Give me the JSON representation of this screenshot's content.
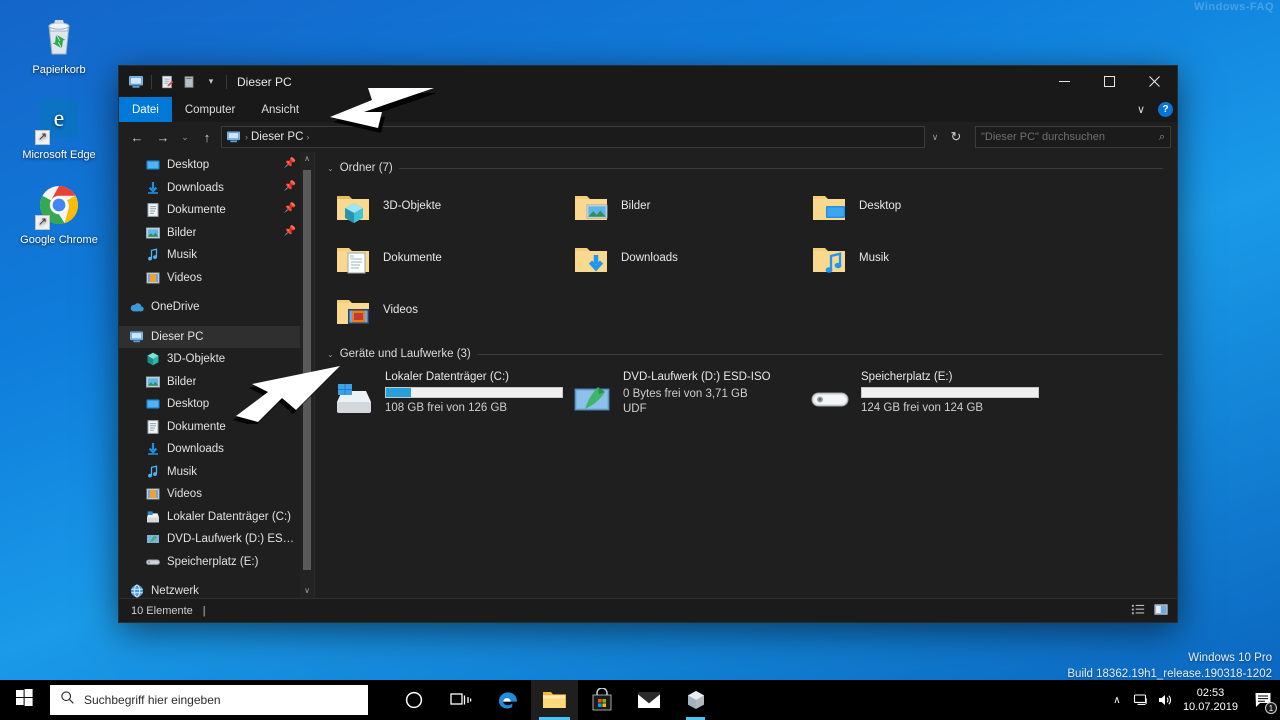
{
  "desktop": {
    "watermark_topright": "Windows-FAQ",
    "build_line1": "Windows 10 Pro",
    "build_line2": "Build 18362.19h1_release.190318-1202",
    "icons": [
      {
        "label": "Papierkorb",
        "icon": "recycle-bin-icon"
      },
      {
        "label": "Microsoft Edge",
        "icon": "edge-icon"
      },
      {
        "label": "Google Chrome",
        "icon": "chrome-icon"
      }
    ]
  },
  "window": {
    "title": "Dieser PC",
    "quick_access": [
      {
        "name": "properties-icon",
        "glyph": "✎"
      },
      {
        "name": "new-folder-icon",
        "glyph": "▤"
      },
      {
        "name": "qat-dropdown-icon",
        "glyph": "▾"
      }
    ],
    "controls": {
      "minimize": "─",
      "maximize": "☐",
      "close": "✕"
    },
    "ribbon": {
      "tabs": [
        {
          "label": "Datei",
          "active": true
        },
        {
          "label": "Computer",
          "active": false
        },
        {
          "label": "Ansicht",
          "active": false
        }
      ],
      "expand_label": "∨",
      "help_label": "?"
    },
    "address": {
      "back": "←",
      "forward": "→",
      "recent": "⌄",
      "up": "↑",
      "crumb_icon": "this-pc-icon",
      "crumb_text": "Dieser PC",
      "crumb_sep": "›",
      "history_caret": "∨",
      "refresh": "↻",
      "search_placeholder": "\"Dieser PC\" durchsuchen",
      "search_value": "",
      "search_icon": "⌕"
    },
    "status": {
      "item_count": "10 Elemente",
      "separator": "|",
      "view_details": "details-view-icon",
      "view_tiles": "tiles-view-icon"
    }
  },
  "nav_pane": {
    "scroll_up": "∧",
    "scroll_down": "∨",
    "items": [
      {
        "label": "Desktop",
        "icon": "desktop-folder-icon",
        "indent": 1,
        "pinned": true,
        "selected": false
      },
      {
        "label": "Downloads",
        "icon": "downloads-icon",
        "indent": 1,
        "pinned": true,
        "selected": false
      },
      {
        "label": "Dokumente",
        "icon": "documents-icon",
        "indent": 1,
        "pinned": true,
        "selected": false
      },
      {
        "label": "Bilder",
        "icon": "pictures-icon",
        "indent": 1,
        "pinned": true,
        "selected": false
      },
      {
        "label": "Musik",
        "icon": "music-icon",
        "indent": 1,
        "pinned": false,
        "selected": false
      },
      {
        "label": "Videos",
        "icon": "videos-icon",
        "indent": 1,
        "pinned": false,
        "selected": false
      },
      {
        "label": "OneDrive",
        "icon": "onedrive-icon",
        "indent": 0,
        "pinned": false,
        "selected": false
      },
      {
        "label": "Dieser PC",
        "icon": "this-pc-icon",
        "indent": 0,
        "pinned": false,
        "selected": true
      },
      {
        "label": "3D-Objekte",
        "icon": "3d-objects-icon",
        "indent": 1,
        "pinned": false,
        "selected": false
      },
      {
        "label": "Bilder",
        "icon": "pictures-icon",
        "indent": 1,
        "pinned": false,
        "selected": false
      },
      {
        "label": "Desktop",
        "icon": "desktop-folder-icon",
        "indent": 1,
        "pinned": false,
        "selected": false
      },
      {
        "label": "Dokumente",
        "icon": "documents-icon",
        "indent": 1,
        "pinned": false,
        "selected": false
      },
      {
        "label": "Downloads",
        "icon": "downloads-icon",
        "indent": 1,
        "pinned": false,
        "selected": false
      },
      {
        "label": "Musik",
        "icon": "music-icon",
        "indent": 1,
        "pinned": false,
        "selected": false
      },
      {
        "label": "Videos",
        "icon": "videos-icon",
        "indent": 1,
        "pinned": false,
        "selected": false
      },
      {
        "label": "Lokaler Datenträger (C:)",
        "icon": "hard-drive-icon",
        "indent": 1,
        "pinned": false,
        "selected": false
      },
      {
        "label": "DVD-Laufwerk (D:) ESD-ISO",
        "icon": "dvd-drive-icon",
        "indent": 1,
        "pinned": false,
        "selected": false
      },
      {
        "label": "Speicherplatz (E:)",
        "icon": "storage-drive-icon",
        "indent": 1,
        "pinned": false,
        "selected": false
      },
      {
        "label": "Netzwerk",
        "icon": "network-icon",
        "indent": 0,
        "pinned": false,
        "selected": false
      }
    ]
  },
  "content": {
    "group_folders": {
      "caret": "⌄",
      "title": "Ordner (7)",
      "items": [
        {
          "label": "3D-Objekte",
          "icon": "folder-3d-objects-icon"
        },
        {
          "label": "Bilder",
          "icon": "folder-pictures-icon"
        },
        {
          "label": "Desktop",
          "icon": "folder-desktop-icon"
        },
        {
          "label": "Dokumente",
          "icon": "folder-documents-icon"
        },
        {
          "label": "Downloads",
          "icon": "folder-downloads-icon"
        },
        {
          "label": "Musik",
          "icon": "folder-music-icon"
        },
        {
          "label": "Videos",
          "icon": "folder-videos-icon"
        }
      ]
    },
    "group_drives": {
      "caret": "⌄",
      "title": "Geräte und Laufwerke (3)",
      "items": [
        {
          "label": "Lokaler Datenträger (C:)",
          "icon": "hard-drive-large-icon",
          "free_text": "108 GB frei von 126 GB",
          "extra_text": "",
          "used_percent": 14,
          "show_bar": true
        },
        {
          "label": "DVD-Laufwerk (D:) ESD-ISO",
          "icon": "dvd-drive-large-icon",
          "free_text": "0 Bytes frei von 3,71 GB",
          "extra_text": "UDF",
          "used_percent": 0,
          "show_bar": false
        },
        {
          "label": "Speicherplatz (E:)",
          "icon": "storage-drive-large-icon",
          "free_text": "124 GB frei von 124 GB",
          "extra_text": "",
          "used_percent": 0,
          "show_bar": true
        }
      ]
    }
  },
  "taskbar": {
    "start_icon": "windows-start-icon",
    "search_placeholder": "Suchbegriff hier eingeben",
    "search_value": "",
    "search_icon": "search-icon",
    "items": [
      {
        "name": "cortana-icon",
        "state": "idle"
      },
      {
        "name": "task-view-icon",
        "state": "idle"
      },
      {
        "name": "edge-taskbar-icon",
        "state": "idle"
      },
      {
        "name": "explorer-taskbar-icon",
        "state": "active"
      },
      {
        "name": "store-icon",
        "state": "idle"
      },
      {
        "name": "mail-icon",
        "state": "idle"
      },
      {
        "name": "3d-viewer-icon",
        "state": "open"
      }
    ],
    "tray": {
      "overflow_caret": "∧",
      "network_icon": "network-tray-icon",
      "volume_icon": "volume-icon",
      "time": "02:53",
      "date": "10.07.2019",
      "notification_icon": "action-center-icon",
      "notification_count": "1"
    }
  },
  "annotations": [
    {
      "name": "arrow-to-address-bar",
      "direction": "left"
    },
    {
      "name": "arrow-to-nav-pane",
      "direction": "upright"
    }
  ],
  "colors": {
    "accent": "#0078d7",
    "window_bg": "#1f1f1f",
    "titlebar_bg": "#191919",
    "selected_row": "#2f2f2f",
    "progress_fill": "#26a0da",
    "desktop_blue": "#0f7ddb"
  }
}
